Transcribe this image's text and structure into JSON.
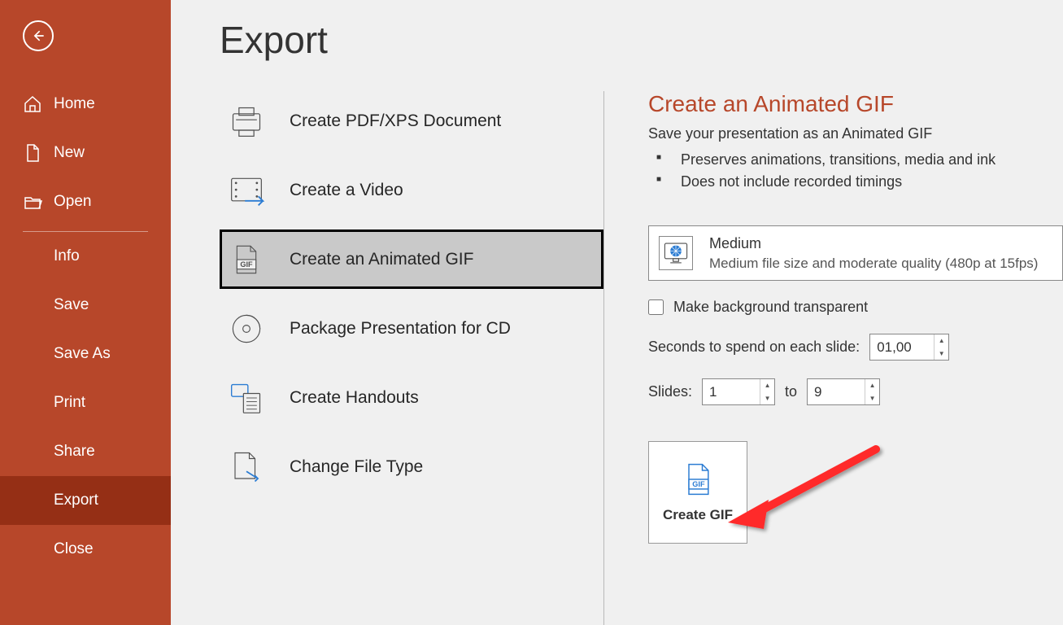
{
  "page": {
    "title": "Export"
  },
  "sidebar": {
    "items": [
      {
        "label": "Home"
      },
      {
        "label": "New"
      },
      {
        "label": "Open"
      },
      {
        "label": "Info"
      },
      {
        "label": "Save"
      },
      {
        "label": "Save As"
      },
      {
        "label": "Print"
      },
      {
        "label": "Share"
      },
      {
        "label": "Export"
      },
      {
        "label": "Close"
      }
    ]
  },
  "exportOptions": {
    "pdf": "Create PDF/XPS Document",
    "video": "Create a Video",
    "gif": "Create an Animated GIF",
    "cd": "Package Presentation for CD",
    "handouts": "Create Handouts",
    "filetype": "Change File Type"
  },
  "right": {
    "title": "Create an Animated GIF",
    "subtitle": "Save your presentation as an Animated GIF",
    "bullets": [
      "Preserves animations, transitions, media and ink",
      "Does not include recorded timings"
    ],
    "quality": {
      "title": "Medium",
      "desc": "Medium file size and moderate quality (480p at 15fps)"
    },
    "transparentLabel": "Make background transparent",
    "secondsLabel": "Seconds to spend on each slide:",
    "secondsValue": "01,00",
    "slidesLabel": "Slides:",
    "slidesFrom": "1",
    "slidesToLabel": "to",
    "slidesTo": "9",
    "createBtn": "Create GIF"
  }
}
